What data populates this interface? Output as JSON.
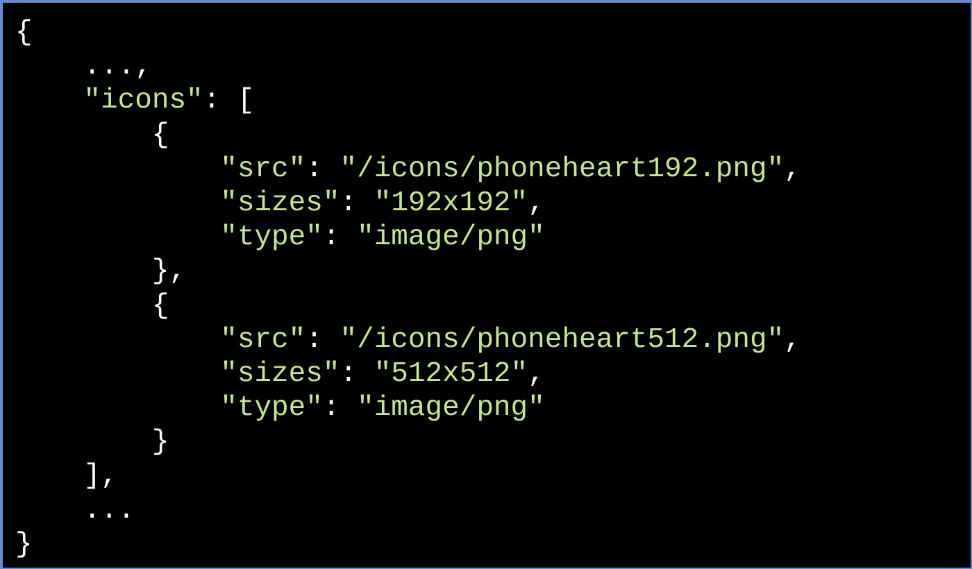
{
  "colors": {
    "background": "#000000",
    "border": "#5b8ed4",
    "punctuation": "#ffffff",
    "string": "#c2e98d"
  },
  "code": {
    "open_brace": "{",
    "ellipsis_comma": "...,",
    "icons_key": "\"icons\"",
    "icons_sep": ": [",
    "items": [
      {
        "open": "{",
        "src_key": "\"src\"",
        "src_value": "\"/icons/phoneheart192.png\"",
        "sizes_key": "\"sizes\"",
        "sizes_value": "\"192x192\"",
        "type_key": "\"type\"",
        "type_value": "\"image/png\"",
        "close": "},"
      },
      {
        "open": "{",
        "src_key": "\"src\"",
        "src_value": "\"/icons/phoneheart512.png\"",
        "sizes_key": "\"sizes\"",
        "sizes_value": "\"512x512\"",
        "type_key": "\"type\"",
        "type_value": "\"image/png\"",
        "close": "}"
      }
    ],
    "close_array": "],",
    "ellipsis": "...",
    "close_brace": "}",
    "colon": ": ",
    "comma": ","
  }
}
